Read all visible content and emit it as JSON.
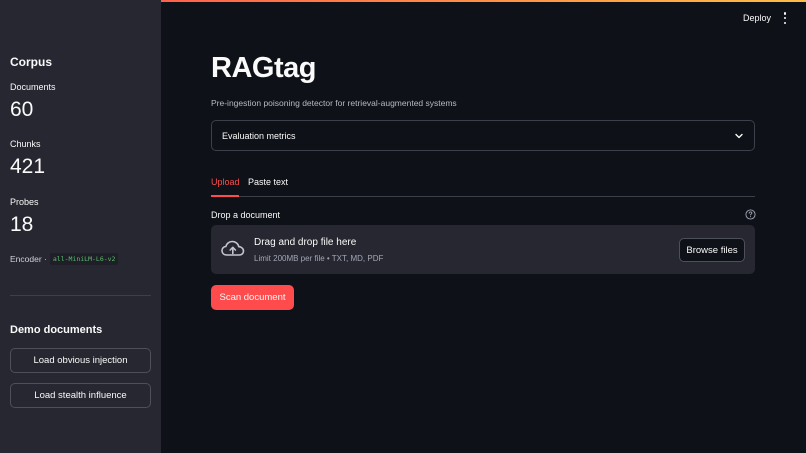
{
  "header": {
    "deploy_label": "Deploy",
    "menu_icon": "kebab-menu-icon"
  },
  "sidebar": {
    "title": "Corpus",
    "metrics": [
      {
        "label": "Documents",
        "value": "60"
      },
      {
        "label": "Chunks",
        "value": "421"
      },
      {
        "label": "Probes",
        "value": "18"
      }
    ],
    "encoder_label": "Encoder ·",
    "encoder_value": "all-MiniLM-L6-v2",
    "demo_title": "Demo documents",
    "demo_buttons": [
      {
        "label": "Load obvious injection"
      },
      {
        "label": "Load stealth influence"
      }
    ]
  },
  "main": {
    "title": "RAGtag",
    "subtitle": "Pre-ingestion poisoning detector for retrieval-augmented systems",
    "expander_label": "Evaluation metrics",
    "tabs": [
      {
        "label": "Upload",
        "active": true
      },
      {
        "label": "Paste text",
        "active": false
      }
    ],
    "uploader": {
      "label": "Drop a document",
      "title": "Drag and drop file here",
      "limit": "Limit 200MB per file • TXT, MD, PDF",
      "browse_label": "Browse files"
    },
    "scan_label": "Scan document"
  },
  "colors": {
    "background": "#0e1117",
    "sidebar": "#262730",
    "accent": "#ff4b4b",
    "code": "#5ebd71"
  }
}
